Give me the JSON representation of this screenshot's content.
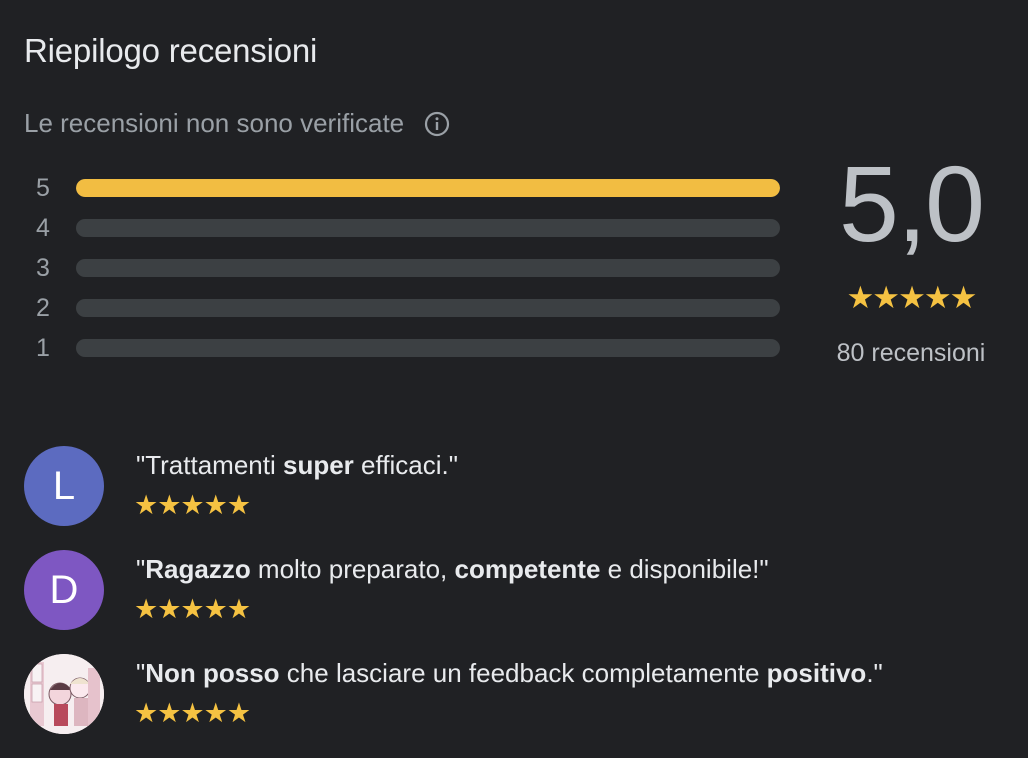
{
  "header": {
    "title": "Riepilogo recensioni",
    "subtitle": "Le recensioni non sono verificate"
  },
  "distribution": [
    {
      "label": "5",
      "fraction": 1.0
    },
    {
      "label": "4",
      "fraction": 0.0
    },
    {
      "label": "3",
      "fraction": 0.0
    },
    {
      "label": "2",
      "fraction": 0.0
    },
    {
      "label": "1",
      "fraction": 0.0
    }
  ],
  "summary": {
    "score": "5,0",
    "stars": "★★★★★",
    "count": "80 recensioni"
  },
  "reviews": [
    {
      "initial": "L",
      "avatar_color": "#5c6bc0",
      "open_quote": "\"",
      "segments": [
        {
          "text": "Trattamenti ",
          "bold": false
        },
        {
          "text": "super",
          "bold": true
        },
        {
          "text": " efficaci.\"",
          "bold": false
        }
      ],
      "stars": "★★★★★"
    },
    {
      "initial": "D",
      "avatar_color": "#7e57c2",
      "open_quote": "\"",
      "segments": [
        {
          "text": "Ragazzo",
          "bold": true
        },
        {
          "text": " molto preparato, ",
          "bold": false
        },
        {
          "text": "competente",
          "bold": true
        },
        {
          "text": " e disponibile!\"",
          "bold": false
        }
      ],
      "stars": "★★★★★"
    },
    {
      "initial": "",
      "avatar_color": "#f3e6ea",
      "open_quote": "\"",
      "segments": [
        {
          "text": "Non posso",
          "bold": true
        },
        {
          "text": " che lasciare un feedback completamente ",
          "bold": false
        },
        {
          "text": "positivo",
          "bold": true
        },
        {
          "text": ".\"",
          "bold": false
        }
      ],
      "stars": "★★★★★"
    }
  ],
  "colors": {
    "background": "#202124",
    "bar_fill": "#f2bd42",
    "bar_track": "#3c4043",
    "star": "#f5c242"
  }
}
